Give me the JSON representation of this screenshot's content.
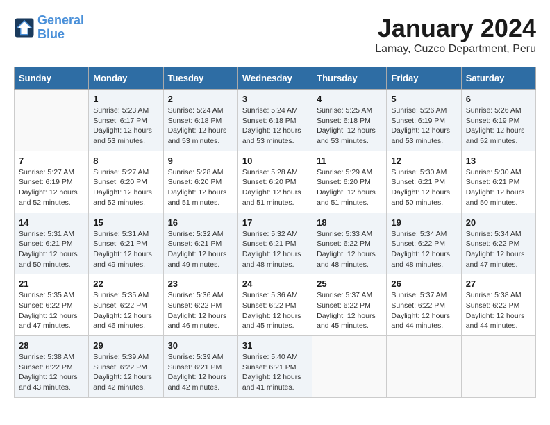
{
  "logo": {
    "line1": "General",
    "line2": "Blue"
  },
  "title": "January 2024",
  "subtitle": "Lamay, Cuzco Department, Peru",
  "weekdays": [
    "Sunday",
    "Monday",
    "Tuesday",
    "Wednesday",
    "Thursday",
    "Friday",
    "Saturday"
  ],
  "weeks": [
    [
      {
        "day": "",
        "info": ""
      },
      {
        "day": "1",
        "info": "Sunrise: 5:23 AM\nSunset: 6:17 PM\nDaylight: 12 hours\nand 53 minutes."
      },
      {
        "day": "2",
        "info": "Sunrise: 5:24 AM\nSunset: 6:18 PM\nDaylight: 12 hours\nand 53 minutes."
      },
      {
        "day": "3",
        "info": "Sunrise: 5:24 AM\nSunset: 6:18 PM\nDaylight: 12 hours\nand 53 minutes."
      },
      {
        "day": "4",
        "info": "Sunrise: 5:25 AM\nSunset: 6:18 PM\nDaylight: 12 hours\nand 53 minutes."
      },
      {
        "day": "5",
        "info": "Sunrise: 5:26 AM\nSunset: 6:19 PM\nDaylight: 12 hours\nand 53 minutes."
      },
      {
        "day": "6",
        "info": "Sunrise: 5:26 AM\nSunset: 6:19 PM\nDaylight: 12 hours\nand 52 minutes."
      }
    ],
    [
      {
        "day": "7",
        "info": "Sunrise: 5:27 AM\nSunset: 6:19 PM\nDaylight: 12 hours\nand 52 minutes."
      },
      {
        "day": "8",
        "info": "Sunrise: 5:27 AM\nSunset: 6:20 PM\nDaylight: 12 hours\nand 52 minutes."
      },
      {
        "day": "9",
        "info": "Sunrise: 5:28 AM\nSunset: 6:20 PM\nDaylight: 12 hours\nand 51 minutes."
      },
      {
        "day": "10",
        "info": "Sunrise: 5:28 AM\nSunset: 6:20 PM\nDaylight: 12 hours\nand 51 minutes."
      },
      {
        "day": "11",
        "info": "Sunrise: 5:29 AM\nSunset: 6:20 PM\nDaylight: 12 hours\nand 51 minutes."
      },
      {
        "day": "12",
        "info": "Sunrise: 5:30 AM\nSunset: 6:21 PM\nDaylight: 12 hours\nand 50 minutes."
      },
      {
        "day": "13",
        "info": "Sunrise: 5:30 AM\nSunset: 6:21 PM\nDaylight: 12 hours\nand 50 minutes."
      }
    ],
    [
      {
        "day": "14",
        "info": "Sunrise: 5:31 AM\nSunset: 6:21 PM\nDaylight: 12 hours\nand 50 minutes."
      },
      {
        "day": "15",
        "info": "Sunrise: 5:31 AM\nSunset: 6:21 PM\nDaylight: 12 hours\nand 49 minutes."
      },
      {
        "day": "16",
        "info": "Sunrise: 5:32 AM\nSunset: 6:21 PM\nDaylight: 12 hours\nand 49 minutes."
      },
      {
        "day": "17",
        "info": "Sunrise: 5:32 AM\nSunset: 6:21 PM\nDaylight: 12 hours\nand 48 minutes."
      },
      {
        "day": "18",
        "info": "Sunrise: 5:33 AM\nSunset: 6:22 PM\nDaylight: 12 hours\nand 48 minutes."
      },
      {
        "day": "19",
        "info": "Sunrise: 5:34 AM\nSunset: 6:22 PM\nDaylight: 12 hours\nand 48 minutes."
      },
      {
        "day": "20",
        "info": "Sunrise: 5:34 AM\nSunset: 6:22 PM\nDaylight: 12 hours\nand 47 minutes."
      }
    ],
    [
      {
        "day": "21",
        "info": "Sunrise: 5:35 AM\nSunset: 6:22 PM\nDaylight: 12 hours\nand 47 minutes."
      },
      {
        "day": "22",
        "info": "Sunrise: 5:35 AM\nSunset: 6:22 PM\nDaylight: 12 hours\nand 46 minutes."
      },
      {
        "day": "23",
        "info": "Sunrise: 5:36 AM\nSunset: 6:22 PM\nDaylight: 12 hours\nand 46 minutes."
      },
      {
        "day": "24",
        "info": "Sunrise: 5:36 AM\nSunset: 6:22 PM\nDaylight: 12 hours\nand 45 minutes."
      },
      {
        "day": "25",
        "info": "Sunrise: 5:37 AM\nSunset: 6:22 PM\nDaylight: 12 hours\nand 45 minutes."
      },
      {
        "day": "26",
        "info": "Sunrise: 5:37 AM\nSunset: 6:22 PM\nDaylight: 12 hours\nand 44 minutes."
      },
      {
        "day": "27",
        "info": "Sunrise: 5:38 AM\nSunset: 6:22 PM\nDaylight: 12 hours\nand 44 minutes."
      }
    ],
    [
      {
        "day": "28",
        "info": "Sunrise: 5:38 AM\nSunset: 6:22 PM\nDaylight: 12 hours\nand 43 minutes."
      },
      {
        "day": "29",
        "info": "Sunrise: 5:39 AM\nSunset: 6:22 PM\nDaylight: 12 hours\nand 42 minutes."
      },
      {
        "day": "30",
        "info": "Sunrise: 5:39 AM\nSunset: 6:21 PM\nDaylight: 12 hours\nand 42 minutes."
      },
      {
        "day": "31",
        "info": "Sunrise: 5:40 AM\nSunset: 6:21 PM\nDaylight: 12 hours\nand 41 minutes."
      },
      {
        "day": "",
        "info": ""
      },
      {
        "day": "",
        "info": ""
      },
      {
        "day": "",
        "info": ""
      }
    ]
  ]
}
